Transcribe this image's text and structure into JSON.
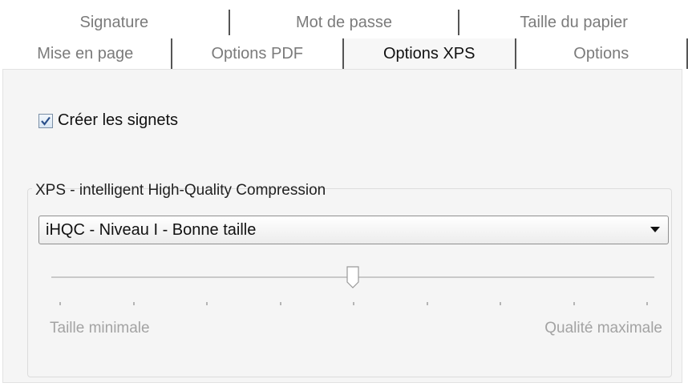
{
  "tabs_back": [
    {
      "label": "Signature"
    },
    {
      "label": "Mot de passe"
    },
    {
      "label": "Taille du papier"
    }
  ],
  "tabs_front": [
    {
      "label": "Mise en page",
      "active": false
    },
    {
      "label": "Options PDF",
      "active": false
    },
    {
      "label": "Options XPS",
      "active": true
    },
    {
      "label": "Options",
      "active": false
    }
  ],
  "bookmarks": {
    "label": "Créer les signets",
    "checked": true
  },
  "compression": {
    "group_title": "XPS - intelligent High-Quality Compression",
    "selected": "iHQC - Niveau I - Bonne taille",
    "slider": {
      "min_label": "Taille minimale",
      "max_label": "Qualité maximale",
      "value_fraction": 0.5,
      "tick_count": 9
    }
  },
  "colors": {
    "active_tab_text": "#111111",
    "inactive_tab_text": "#7b7b7b",
    "panel_bg": "#f5f5f5"
  }
}
